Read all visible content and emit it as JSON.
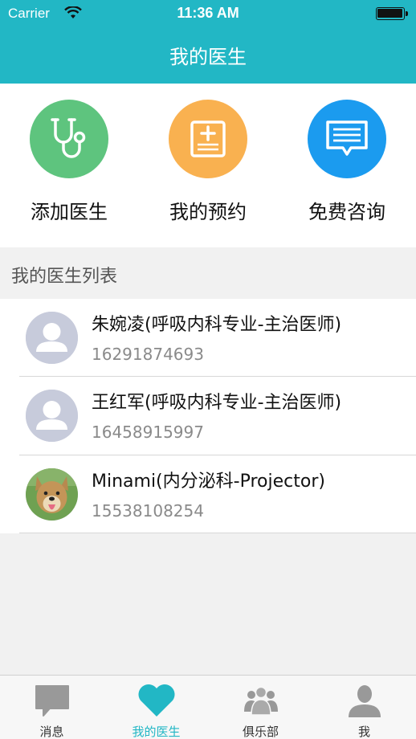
{
  "status_bar": {
    "carrier": "Carrier",
    "time": "11:36 AM"
  },
  "header": {
    "title": "我的医生",
    "background": "#22b7c5"
  },
  "actions": [
    {
      "label": "添加医生",
      "icon": "stethoscope-icon",
      "color": "#5ec47e"
    },
    {
      "label": "我的预约",
      "icon": "medical-record-icon",
      "color": "#f9b150"
    },
    {
      "label": "免费咨询",
      "icon": "chat-bubble-icon",
      "color": "#1b9bef"
    }
  ],
  "section": {
    "title": "我的医生列表"
  },
  "doctors": [
    {
      "name": "朱婉凌(呼吸内科专业-主治医师)",
      "phone": "16291874693",
      "avatar": "default-avatar"
    },
    {
      "name": "王红军(呼吸内科专业-主治医师)",
      "phone": "16458915997",
      "avatar": "default-avatar"
    },
    {
      "name": "Minami(内分泌科-Projector)",
      "phone": "15538108254",
      "avatar": "dog-photo"
    }
  ],
  "tab_bar": {
    "active": "我的医生",
    "tabs": [
      {
        "label": "消息",
        "icon": "message-icon"
      },
      {
        "label": "我的医生",
        "icon": "heart-icon"
      },
      {
        "label": "俱乐部",
        "icon": "group-icon"
      },
      {
        "label": "我",
        "icon": "person-icon"
      }
    ]
  }
}
